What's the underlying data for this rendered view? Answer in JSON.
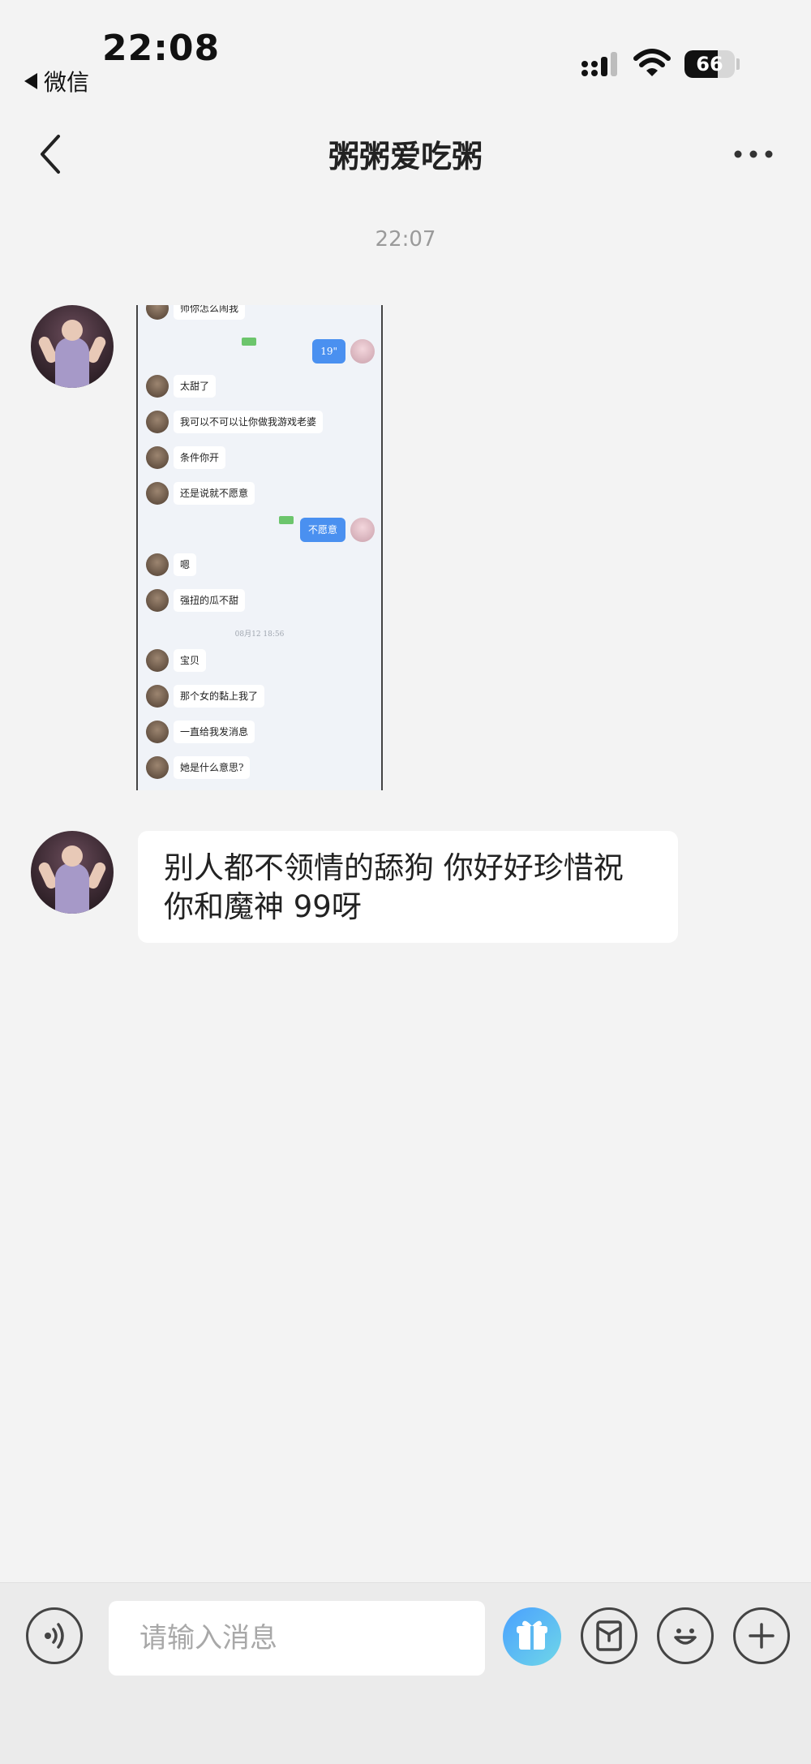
{
  "status_bar": {
    "time": "22:08",
    "back_app": "微信",
    "battery": "66",
    "battery_level": 0.66
  },
  "nav": {
    "title": "粥粥爱吃粥",
    "back_icon": "chevron-left-icon",
    "more_icon": "more-dots-icon"
  },
  "chat": {
    "timestamp": "22:07",
    "image_message": {
      "rows": [
        {
          "side": "left",
          "text": "师你怎么闹我"
        },
        {
          "side": "right",
          "text": "19\""
        },
        {
          "side": "left",
          "text": "太甜了"
        },
        {
          "side": "left",
          "text": "我可以不可以让你做我游戏老婆"
        },
        {
          "side": "left",
          "text": "条件你开"
        },
        {
          "side": "left",
          "text": "还是说就不愿意"
        },
        {
          "side": "right",
          "text": "不愿意"
        },
        {
          "side": "left",
          "text": "嗯"
        },
        {
          "side": "left",
          "text": "强扭的瓜不甜"
        },
        {
          "side": "time",
          "text": "08月12 18:56"
        },
        {
          "side": "left",
          "text": "宝贝"
        },
        {
          "side": "left",
          "text": "那个女的黏上我了"
        },
        {
          "side": "left",
          "text": "一直给我发消息"
        },
        {
          "side": "left",
          "text": "她是什么意思?"
        }
      ]
    },
    "text_message": {
      "line1": "别人都不领情的舔狗 你好好珍惜祝",
      "line2": "你和魔神 99呀"
    }
  },
  "input_bar": {
    "placeholder": "请输入消息",
    "voice_icon": "voice-icon",
    "gift_icon": "gift-icon",
    "red-packet_icon": "red-packet-icon",
    "emoji_icon": "emoji-icon",
    "plus_icon": "plus-icon"
  }
}
